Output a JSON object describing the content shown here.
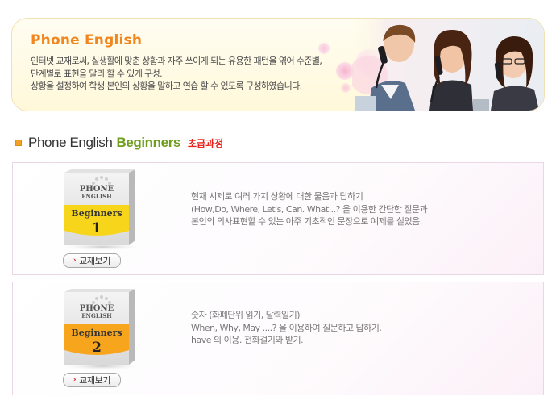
{
  "banner": {
    "title": "Phone English",
    "description": [
      "인터넷 교재로써, 실생활에 맞춘 상황과 자주 쓰이게 되는 유용한 패턴을 엮어 수준별,",
      "단계별로 표현을 달리 할 수 있게 구성.",
      "상황을 설정하여 학생 본인의 상황을 말하고 연습 할 수 있도록 구성하였습니다."
    ]
  },
  "section": {
    "title_main": "Phone English",
    "title_accent": "Beginners",
    "title_sub": "초급과정"
  },
  "courses": [
    {
      "book": {
        "line1": "PHONE",
        "line2": "ENGLISH",
        "level": "Beginners",
        "number": "1"
      },
      "button_label": "교재보기",
      "description": [
        "현재 시제로 여러 가지 상황에 대한 물음과 답하기",
        "(How,Do, Where, Let's, Can. What...? 을 이용한 간단한 질문과",
        "본인의 의사표현할 수 있는 아주 기초적인 문장으로 예제를 실었음."
      ]
    },
    {
      "book": {
        "line1": "PHONE",
        "line2": "ENGLISH",
        "level": "Beginners",
        "number": "2"
      },
      "button_label": "교재보기",
      "description": [
        "숫자 (화폐단위 읽기, 달력일기)",
        "When, Why, May ....? 을 이용하여 질문하고 답하기.",
        "have 의 이용. 전화걸기와 받기."
      ]
    }
  ],
  "colors": {
    "banner_title": "#f2861e",
    "accent_green": "#6e9e1c",
    "sub_red": "#e8261f",
    "book_band_1": "#f7d51a",
    "book_band_2": "#f7a51c"
  }
}
